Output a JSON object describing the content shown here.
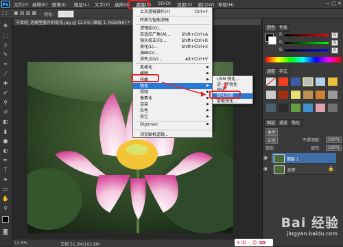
{
  "app": {
    "logo": "Ps"
  },
  "menubar": {
    "items": [
      "文件(F)",
      "编辑(E)",
      "图像(I)",
      "图层(L)",
      "文字(Y)",
      "选择(S)",
      "滤镜(T)",
      "3D(D)",
      "视图(V)",
      "窗口(W)",
      "帮助(H)"
    ],
    "window_controls": "— □ ✕"
  },
  "options_bar": {
    "feather_label": "羽化:",
    "feather_value": "0 像素"
  },
  "document": {
    "tab_title": "千库网_池塘里盛开的荷花.jpg @ 12.5% (图层 1, RGB/8#) *"
  },
  "status_bar": {
    "zoom": "12.5%",
    "doc_info": "文档:51.3M/102.6M"
  },
  "filter_menu": {
    "items": [
      {
        "label": "上次滤镜操作(F)",
        "shortcut": "Ctrl+F"
      },
      {
        "label": "转换为智能滤镜",
        "shortcut": ""
      },
      {
        "label": "滤镜库(G)...",
        "shortcut": ""
      },
      {
        "label": "自适应广角(A)...",
        "shortcut": "Shift+Ctrl+A"
      },
      {
        "label": "镜头校正(R)...",
        "shortcut": "Shift+Ctrl+R"
      },
      {
        "label": "液化(L)...",
        "shortcut": "Shift+Ctrl+X"
      },
      {
        "label": "油画(O)...",
        "shortcut": ""
      },
      {
        "label": "消失点(V)...",
        "shortcut": "Alt+Ctrl+V"
      },
      {
        "label": "风格化",
        "shortcut": ""
      },
      {
        "label": "模糊",
        "shortcut": ""
      },
      {
        "label": "扭曲",
        "shortcut": ""
      },
      {
        "label": "锐化",
        "shortcut": ""
      },
      {
        "label": "视频",
        "shortcut": ""
      },
      {
        "label": "像素化",
        "shortcut": ""
      },
      {
        "label": "渲染",
        "shortcut": ""
      },
      {
        "label": "杂色",
        "shortcut": ""
      },
      {
        "label": "其它",
        "shortcut": ""
      },
      {
        "label": "Digimarc",
        "shortcut": ""
      },
      {
        "label": "浏览联机滤镜...",
        "shortcut": ""
      }
    ],
    "submenu_arrow": "▶"
  },
  "sharpen_submenu": {
    "items": [
      "USM 锐化...",
      "进一步锐化",
      "锐化",
      "锐化边缘",
      "智能锐化..."
    ]
  },
  "panels": {
    "color_tabs": [
      "颜色",
      "色板"
    ],
    "color_labels": [
      "R",
      "G",
      "B"
    ],
    "color_values": [
      "0",
      "0",
      "0"
    ],
    "adjust_tabs": [
      "调整",
      "样式"
    ],
    "layers_tabs": [
      "图层",
      "通道",
      "路径"
    ],
    "layer_kind": "类型",
    "blend_mode": "正常",
    "opacity_label": "不透明度:",
    "opacity_value": "100%",
    "lock_label": "锁定:",
    "fill_label": "填充:",
    "fill_value": "100%",
    "layers": [
      "图层 1",
      "背景"
    ]
  },
  "watermark": {
    "text": "Bai 经验",
    "url": "jingyan.baidu.com"
  },
  "ime": {
    "text": "S 中 ·, ☺ ⌨"
  },
  "colors": {
    "highlight": "#e0232a",
    "accent": "#2a78d6"
  }
}
